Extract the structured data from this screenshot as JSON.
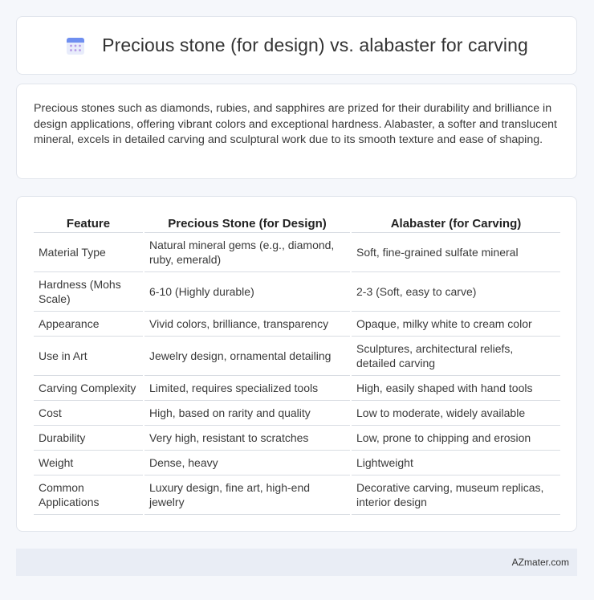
{
  "header": {
    "title": "Precious stone (for design) vs. alabaster for carving",
    "icon": "calendar-icon"
  },
  "intro": {
    "text": "Precious stones such as diamonds, rubies, and sapphires are prized for their durability and brilliance in design applications, offering vibrant colors and exceptional hardness. Alabaster, a softer and translucent mineral, excels in detailed carving and sculptural work due to its smooth texture and ease of shaping."
  },
  "table": {
    "headers": [
      "Feature",
      "Precious Stone (for Design)",
      "Alabaster (for Carving)"
    ],
    "rows": [
      [
        "Material Type",
        "Natural mineral gems (e.g., diamond, ruby, emerald)",
        "Soft, fine-grained sulfate mineral"
      ],
      [
        "Hardness (Mohs Scale)",
        "6-10 (Highly durable)",
        "2-3 (Soft, easy to carve)"
      ],
      [
        "Appearance",
        "Vivid colors, brilliance, transparency",
        "Opaque, milky white to cream color"
      ],
      [
        "Use in Art",
        "Jewelry design, ornamental detailing",
        "Sculptures, architectural reliefs, detailed carving"
      ],
      [
        "Carving Complexity",
        "Limited, requires specialized tools",
        "High, easily shaped with hand tools"
      ],
      [
        "Cost",
        "High, based on rarity and quality",
        "Low to moderate, widely available"
      ],
      [
        "Durability",
        "Very high, resistant to scratches",
        "Low, prone to chipping and erosion"
      ],
      [
        "Weight",
        "Dense, heavy",
        "Lightweight"
      ],
      [
        "Common Applications",
        "Luxury design, fine art, high-end jewelry",
        "Decorative carving, museum replicas, interior design"
      ]
    ]
  },
  "footer": {
    "text": "AZmater.com"
  },
  "colors": {
    "background": "#f5f7fb",
    "card": "#ffffff",
    "footer_bg": "#e9edf5",
    "icon_blue": "#5b8def",
    "icon_purple": "#a98be8"
  }
}
